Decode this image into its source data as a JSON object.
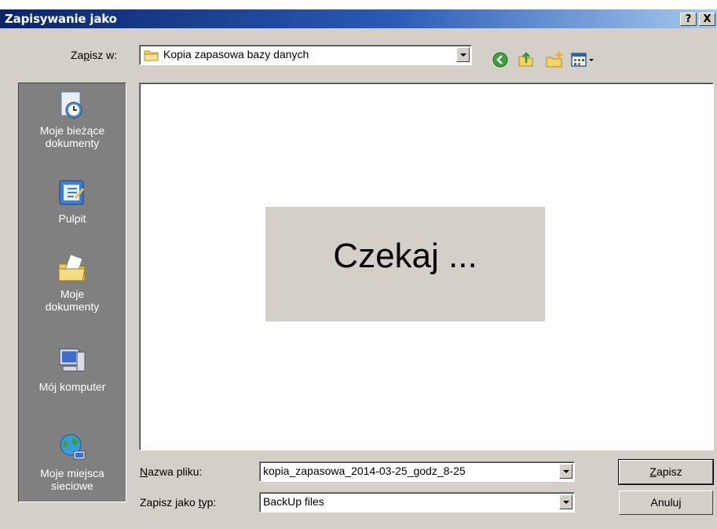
{
  "window": {
    "title": "Zapisywanie jako",
    "help_button": "?",
    "close_button": "X"
  },
  "save_in": {
    "label_pre": "Za",
    "label_u": "p",
    "label_post": "isz w:",
    "current_folder": "Kopia zapasowa bazy danych"
  },
  "toolbar": {
    "icons": [
      "back-icon",
      "up-folder-icon",
      "new-folder-icon",
      "view-menu-icon"
    ]
  },
  "places_bar": {
    "items": [
      {
        "label": "Moje bieżące dokumenty",
        "icon": "recent-documents-icon"
      },
      {
        "label": "Pulpit",
        "icon": "desktop-icon"
      },
      {
        "label": "Moje dokumenty",
        "icon": "my-documents-icon"
      },
      {
        "label": "Mój komputer",
        "icon": "my-computer-icon"
      },
      {
        "label": "Moje miejsca sieciowe",
        "icon": "network-places-icon"
      }
    ]
  },
  "file_list": {
    "status": "Czekaj ..."
  },
  "filename": {
    "label_u": "N",
    "label_post": "azwa pliku:",
    "value": "kopia_zapasowa_2014-03-25_godz_8-25"
  },
  "filetype": {
    "label_pre": "Zapisz jako ",
    "label_u": "t",
    "label_post": "yp:",
    "value": "BackUp files"
  },
  "buttons": {
    "save_u": "Z",
    "save_post": "apisz",
    "cancel": "Anuluj"
  }
}
